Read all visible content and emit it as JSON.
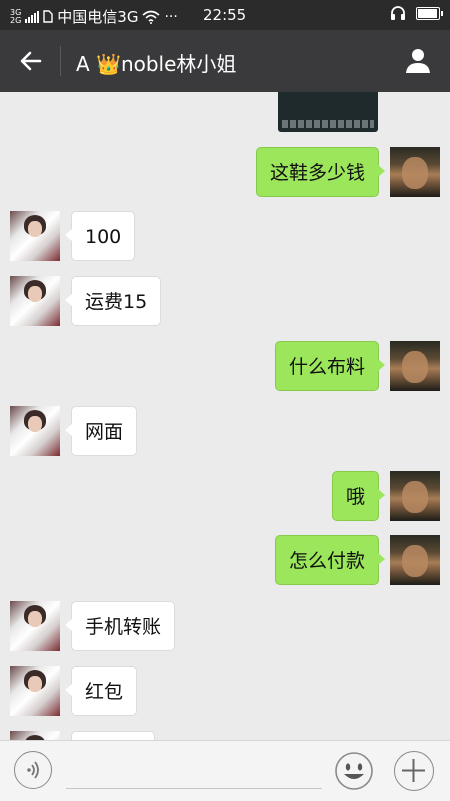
{
  "status_bar": {
    "network_top": "3G",
    "network_bottom": "2G",
    "carrier": "中国电信3G",
    "more_indicator": "···",
    "time": "22:55",
    "battery_level": 0.85,
    "icons": [
      "signal-icon",
      "sim-icon",
      "wifi-icon",
      "headset-icon",
      "battery-icon"
    ]
  },
  "header": {
    "back_icon": "arrow-left-icon",
    "title_prefix": "A ",
    "title_emoji": "👑",
    "title_name": "noble林小姐",
    "profile_icon": "person-icon"
  },
  "messages": [
    {
      "from": "me",
      "type": "image"
    },
    {
      "from": "me",
      "text": "这鞋多少钱"
    },
    {
      "from": "other",
      "text": "100"
    },
    {
      "from": "other",
      "text": "运费15"
    },
    {
      "from": "me",
      "text": "什么布料"
    },
    {
      "from": "other",
      "text": "网面"
    },
    {
      "from": "me",
      "text": "哦"
    },
    {
      "from": "me",
      "text": "怎么付款"
    },
    {
      "from": "other",
      "text": "手机转账"
    },
    {
      "from": "other",
      "text": "红包"
    },
    {
      "from": "other",
      "text": ""
    }
  ],
  "input_bar": {
    "voice_icon": "voice-icon",
    "text_value": "",
    "emoji_icon": "smiley-icon",
    "more_icon": "plus-icon"
  },
  "colors": {
    "status_bar_bg": "#2b2b2b",
    "header_bg": "#3a3a3c",
    "chat_bg": "#ebebeb",
    "my_bubble": "#9be65a",
    "other_bubble": "#ffffff"
  }
}
